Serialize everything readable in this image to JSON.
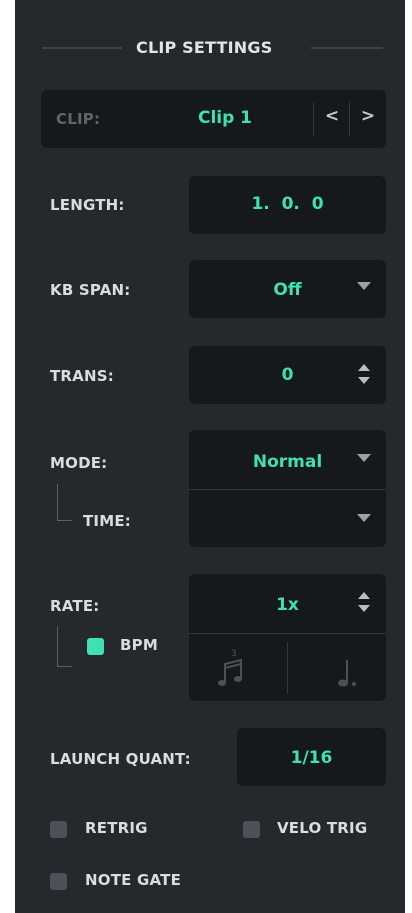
{
  "header": {
    "title": "CLIP SETTINGS"
  },
  "clip": {
    "label": "CLIP:",
    "value": "Clip 1",
    "prev_icon": "<",
    "next_icon": ">"
  },
  "length": {
    "label": "LENGTH:",
    "value": "1.  0.  0"
  },
  "kb_span": {
    "label": "KB SPAN:",
    "value": "Off"
  },
  "trans": {
    "label": "TRANS:",
    "value": "0"
  },
  "mode": {
    "label": "MODE:",
    "value": "Normal"
  },
  "time": {
    "label": "TIME:",
    "value": ""
  },
  "rate": {
    "label": "RATE:",
    "value": "1x"
  },
  "bpm": {
    "label": "BPM",
    "checked": true
  },
  "launch_quant": {
    "label": "LAUNCH QUANT:",
    "value": "1/16"
  },
  "retrig": {
    "label": "RETRIG",
    "checked": false
  },
  "velo_trig": {
    "label": "VELO TRIG",
    "checked": false
  },
  "note_gate": {
    "label": "NOTE GATE",
    "checked": false
  },
  "colors": {
    "panel": "#25282c",
    "field": "#16191c",
    "accent": "#3fe0b4",
    "label": "#d9dde2"
  },
  "icons": {
    "triplet": "triplet-note-icon",
    "dotted": "dotted-note-icon"
  }
}
